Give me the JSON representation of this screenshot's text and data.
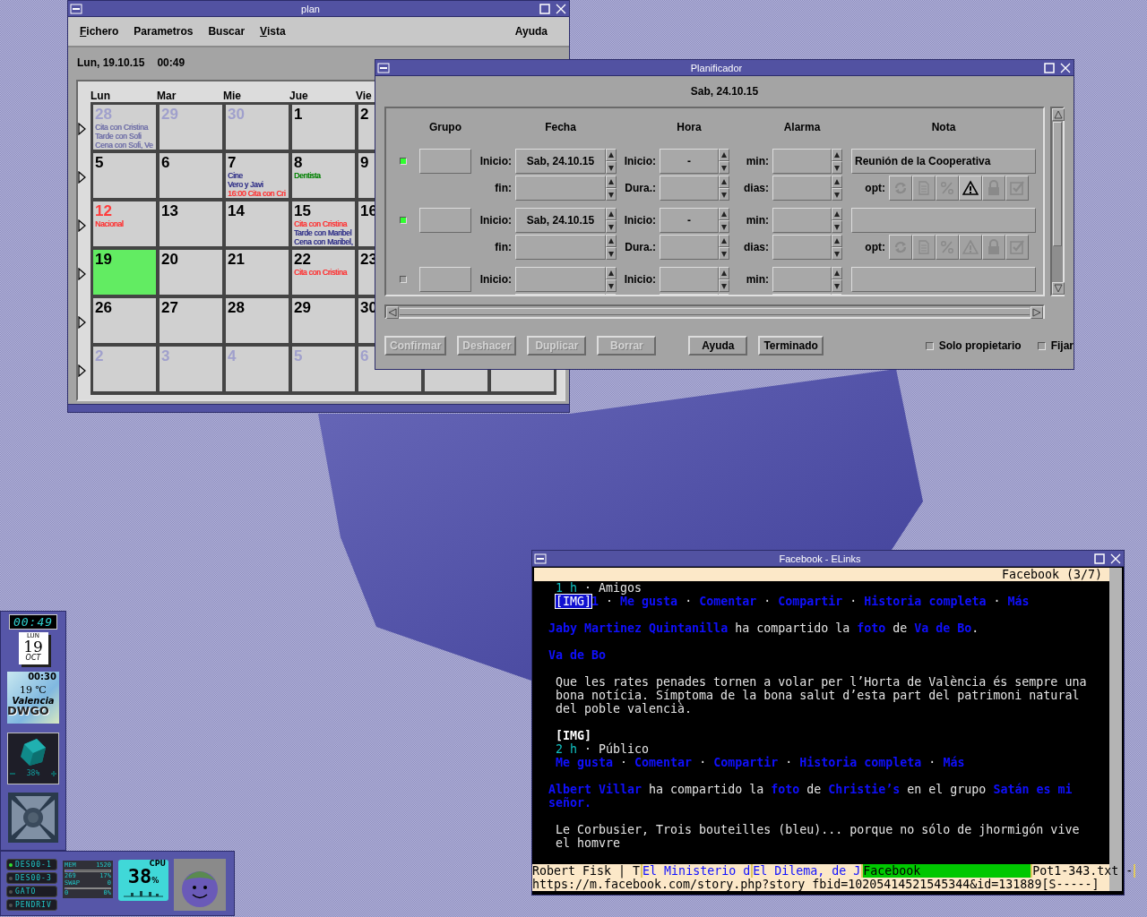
{
  "plan_window": {
    "title": "plan",
    "menu": [
      {
        "label": "Fichero",
        "underline": true
      },
      {
        "label": "Parametros",
        "underline": false
      },
      {
        "label": "Buscar",
        "underline": false
      },
      {
        "label": "Vista",
        "underline": true
      }
    ],
    "help_menu": "Ayuda",
    "date": "Lun, 19.10.15",
    "time": "00:49",
    "weekdays": [
      "Lun",
      "Mar",
      "Mie",
      "Jue",
      "Vie"
    ],
    "weeks": [
      {
        "days": [
          {
            "day": "28",
            "other_month": true,
            "holiday": false,
            "selected": false,
            "events": [
              {
                "text": "Cita con Cristina",
                "color": "#7070a8"
              },
              {
                "text": "Tarde con Sofi",
                "color": "#7070a8"
              },
              {
                "text": "Cena con Sofi, Ve",
                "color": "#7070a8"
              }
            ]
          },
          {
            "day": "29",
            "other_month": true,
            "holiday": false,
            "selected": false
          },
          {
            "day": "30",
            "other_month": true,
            "holiday": false,
            "selected": false
          },
          {
            "day": "1",
            "other_month": false,
            "holiday": false,
            "selected": false
          },
          {
            "day": "2",
            "other_month": false,
            "holiday": false,
            "selected": false
          }
        ]
      },
      {
        "days": [
          {
            "day": "5",
            "other_month": false,
            "holiday": false,
            "selected": false
          },
          {
            "day": "6",
            "other_month": false,
            "holiday": false,
            "selected": false
          },
          {
            "day": "7",
            "other_month": false,
            "holiday": false,
            "selected": false,
            "events": [
              {
                "text": "Cine",
                "color": "#303088"
              },
              {
                "text": "Vero y Javi",
                "color": "#303088"
              },
              {
                "text": "16:00 Cita con Cri",
                "color": "#ff3030"
              }
            ]
          },
          {
            "day": "8",
            "other_month": false,
            "holiday": false,
            "selected": false,
            "events": [
              {
                "text": "Dentista",
                "color": "#008000"
              }
            ]
          },
          {
            "day": "9",
            "other_month": false,
            "holiday": false,
            "selected": false
          }
        ]
      },
      {
        "days": [
          {
            "day": "12",
            "other_month": false,
            "holiday": true,
            "selected": false,
            "events": [
              {
                "text": "Nacional",
                "color": "#ff3030"
              }
            ]
          },
          {
            "day": "13",
            "other_month": false,
            "holiday": false,
            "selected": false
          },
          {
            "day": "14",
            "other_month": false,
            "holiday": false,
            "selected": false
          },
          {
            "day": "15",
            "other_month": false,
            "holiday": false,
            "selected": false,
            "events": [
              {
                "text": "Cita con Cristina",
                "color": "#ff3030"
              },
              {
                "text": "Tarde con Maribel",
                "color": "#303088"
              },
              {
                "text": "Cena con Maribel,",
                "color": "#303088"
              }
            ]
          },
          {
            "day": "16",
            "other_month": false,
            "holiday": false,
            "selected": false
          }
        ]
      },
      {
        "days": [
          {
            "day": "19",
            "other_month": false,
            "holiday": false,
            "selected": true
          },
          {
            "day": "20",
            "other_month": false,
            "holiday": false,
            "selected": false
          },
          {
            "day": "21",
            "other_month": false,
            "holiday": false,
            "selected": false
          },
          {
            "day": "22",
            "other_month": false,
            "holiday": false,
            "selected": false,
            "events": [
              {
                "text": "Cita con Cristina",
                "color": "#ff3030"
              }
            ]
          },
          {
            "day": "23",
            "other_month": false,
            "holiday": false,
            "selected": false
          }
        ]
      },
      {
        "days": [
          {
            "day": "26",
            "other_month": false,
            "holiday": false,
            "selected": false
          },
          {
            "day": "27",
            "other_month": false,
            "holiday": false,
            "selected": false
          },
          {
            "day": "28",
            "other_month": false,
            "holiday": false,
            "selected": false
          },
          {
            "day": "29",
            "other_month": false,
            "holiday": false,
            "selected": false
          },
          {
            "day": "30",
            "other_month": false,
            "holiday": false,
            "selected": false
          }
        ]
      },
      {
        "days": [
          {
            "day": "2",
            "other_month": true,
            "holiday": false,
            "selected": false
          },
          {
            "day": "3",
            "other_month": true,
            "holiday": false,
            "selected": false
          },
          {
            "day": "4",
            "other_month": true,
            "holiday": false,
            "selected": false
          },
          {
            "day": "5",
            "other_month": true,
            "holiday": false,
            "selected": false
          },
          {
            "day": "6",
            "other_month": true,
            "holiday": false,
            "selected": false
          }
        ]
      }
    ]
  },
  "planner_window": {
    "title": "Planificador",
    "date": "Sab, 24.10.15",
    "columns": [
      "Grupo",
      "Fecha",
      "Hora",
      "Alarma",
      "Nota"
    ],
    "entries": [
      {
        "checked": true,
        "labels": {
          "date_start": "Inicio:",
          "date_end": "fin:",
          "time_start": "Inicio:",
          "duration": "Dura.:",
          "alarm_min": "min:",
          "alarm_days": "dias:",
          "options": "opt:"
        },
        "date_start": "Sab, 24.10.15",
        "time_start": "-",
        "note": "Reunión de la Cooperativa",
        "options": [
          {
            "kind": "repeat",
            "on": false
          },
          {
            "kind": "note",
            "on": false
          },
          {
            "kind": "percent",
            "on": false
          },
          {
            "kind": "alarm",
            "on": true
          },
          {
            "kind": "lock",
            "on": false
          },
          {
            "kind": "done",
            "on": false
          }
        ]
      },
      {
        "checked": true,
        "labels": {
          "date_start": "Inicio:",
          "date_end": "fin:",
          "time_start": "Inicio:",
          "duration": "Dura.:",
          "alarm_min": "min:",
          "alarm_days": "dias:",
          "options": "opt:"
        },
        "date_start": "Sab, 24.10.15",
        "time_start": "-",
        "options": [
          {
            "kind": "repeat",
            "on": false
          },
          {
            "kind": "note",
            "on": false
          },
          {
            "kind": "percent",
            "on": false
          },
          {
            "kind": "alarm",
            "on": false
          },
          {
            "kind": "lock",
            "on": false
          },
          {
            "kind": "done",
            "on": false
          }
        ]
      },
      {
        "checked": false,
        "labels": {
          "date_start": "Inicio:",
          "time_start": "Inicio:",
          "alarm_min": "min:"
        }
      }
    ],
    "edit_buttons": [
      {
        "label": "Confirmar",
        "disabled": true
      },
      {
        "label": "Deshacer",
        "disabled": true
      },
      {
        "label": "Duplicar",
        "disabled": true
      },
      {
        "label": "Borrar",
        "disabled": true
      }
    ],
    "dialog_buttons": [
      {
        "label": "Ayuda",
        "disabled": false
      },
      {
        "label": "Terminado",
        "disabled": false
      }
    ],
    "checkboxes": [
      {
        "label": "Solo propietario",
        "checked": false
      },
      {
        "label": "Fijar",
        "checked": false
      }
    ]
  },
  "elinks_window": {
    "title": "Facebook - ELinks",
    "page_title": "Facebook (3/7)",
    "blocks": [
      {
        "lines": [
          {
            "kind": "indented",
            "segments": [
              {
                "text": "1 h",
                "kind": "meta"
              },
              {
                "text": " · Amigos",
                "kind": "plain"
              }
            ]
          },
          {
            "kind": "indented",
            "segments": [
              {
                "text": "[IMG]",
                "kind": "focused"
              },
              {
                "text": "1",
                "kind": "link"
              },
              {
                "text": " · ",
                "kind": "plain"
              },
              {
                "text": "Me gusta",
                "kind": "link"
              },
              {
                "text": " · ",
                "kind": "plain"
              },
              {
                "text": "Comentar",
                "kind": "link"
              },
              {
                "text": " · ",
                "kind": "plain"
              },
              {
                "text": "Compartir",
                "kind": "link"
              },
              {
                "text": " · ",
                "kind": "plain"
              },
              {
                "text": "Historia completa",
                "kind": "link"
              },
              {
                "text": " · ",
                "kind": "plain"
              },
              {
                "text": "Más",
                "kind": "link"
              }
            ]
          }
        ]
      },
      {
        "lines": [
          {
            "kind": "flush",
            "segments": [
              {
                "text": "Jaby Martinez Quintanilla",
                "kind": "link"
              },
              {
                "text": " ha compartido la ",
                "kind": "plain"
              },
              {
                "text": "foto",
                "kind": "link"
              },
              {
                "text": " de ",
                "kind": "plain"
              },
              {
                "text": "Va de Bo",
                "kind": "link"
              },
              {
                "text": ".",
                "kind": "plain"
              }
            ]
          }
        ]
      },
      {
        "lines": [
          {
            "kind": "flush",
            "segments": [
              {
                "text": "Va de Bo",
                "kind": "link"
              }
            ]
          }
        ]
      },
      {
        "lines": [
          {
            "kind": "indented",
            "segments": [
              {
                "text": "Que les rates penades tornen a volar per l’Horta de València és sempre una",
                "kind": "plain"
              }
            ]
          },
          {
            "kind": "indented",
            "segments": [
              {
                "text": "bona notícia. Símptoma de la bona salut d’esta part del patrimoni natural",
                "kind": "plain"
              }
            ]
          },
          {
            "kind": "indented",
            "segments": [
              {
                "text": "del poble valencià.",
                "kind": "plain"
              }
            ]
          }
        ]
      },
      {
        "lines": [
          {
            "kind": "indented",
            "segments": [
              {
                "text": "[IMG]",
                "kind": "strong"
              }
            ]
          },
          {
            "kind": "indented",
            "segments": [
              {
                "text": "2 h",
                "kind": "meta"
              },
              {
                "text": " · Público",
                "kind": "plain"
              }
            ]
          },
          {
            "kind": "indented",
            "segments": [
              {
                "text": "Me gusta",
                "kind": "link"
              },
              {
                "text": " · ",
                "kind": "plain"
              },
              {
                "text": "Comentar",
                "kind": "link"
              },
              {
                "text": " · ",
                "kind": "plain"
              },
              {
                "text": "Compartir",
                "kind": "link"
              },
              {
                "text": " · ",
                "kind": "plain"
              },
              {
                "text": "Historia completa",
                "kind": "link"
              },
              {
                "text": " · ",
                "kind": "plain"
              },
              {
                "text": "Más",
                "kind": "link"
              }
            ]
          }
        ]
      },
      {
        "lines": [
          {
            "kind": "flush",
            "segments": [
              {
                "text": "Albert Villar",
                "kind": "link"
              },
              {
                "text": " ha compartido la ",
                "kind": "plain"
              },
              {
                "text": "foto",
                "kind": "link"
              },
              {
                "text": " de ",
                "kind": "plain"
              },
              {
                "text": "Christie’s",
                "kind": "link"
              },
              {
                "text": " en el grupo ",
                "kind": "plain"
              },
              {
                "text": "Satán es mi",
                "kind": "link"
              }
            ]
          },
          {
            "kind": "flush",
            "segments": [
              {
                "text": "señor.",
                "kind": "link"
              }
            ]
          }
        ]
      },
      {
        "lines": [
          {
            "kind": "indented",
            "segments": [
              {
                "text": "Le Corbusier, Trois bouteilles (bleu)... porque no sólo de jhormigón vive",
                "kind": "plain"
              }
            ]
          },
          {
            "kind": "indented",
            "segments": [
              {
                "text": "el homvre",
                "kind": "plain"
              }
            ]
          }
        ]
      }
    ],
    "tabs": [
      {
        "label": "Robert Fisk | T",
        "selected": false,
        "kind": "plain"
      },
      {
        "label": "El Ministerio d",
        "selected": false,
        "kind": "link"
      },
      {
        "label": "El Dilema, de J",
        "selected": false,
        "kind": "link"
      },
      {
        "label": "Facebook",
        "selected": true,
        "kind": "plain"
      },
      {
        "label": "Pot1-343.txt -",
        "selected": false,
        "kind": "plain"
      }
    ],
    "url": "https://m.facebook.com/story.php?story_fbid=10205414521545344&id=131889[S-----]"
  },
  "dock": {
    "clock": "00:49",
    "calendar": {
      "weekday": "LUN",
      "day": "19",
      "month": "OCT"
    },
    "weather": {
      "time": "00:30",
      "temperature": "19 ℃",
      "city": "Valencia",
      "station": "DWGO"
    },
    "cube_reading": "38%"
  },
  "panel": {
    "drives": [
      {
        "label": "DES00-1",
        "mounted": true
      },
      {
        "label": "DES00-3",
        "mounted": false
      },
      {
        "label": "GATO",
        "mounted": false
      },
      {
        "label": "PENDRIV",
        "mounted": false
      }
    ],
    "memory": {
      "label": "MEM",
      "total": "1520",
      "used": "269",
      "percent": "17%",
      "level": 0.17
    },
    "swap": {
      "label": "SWAP",
      "total": "0",
      "used": "0",
      "percent": "0%",
      "level": 0
    },
    "cpu": {
      "label": "CPU",
      "reading": "38",
      "unit": "%"
    }
  }
}
